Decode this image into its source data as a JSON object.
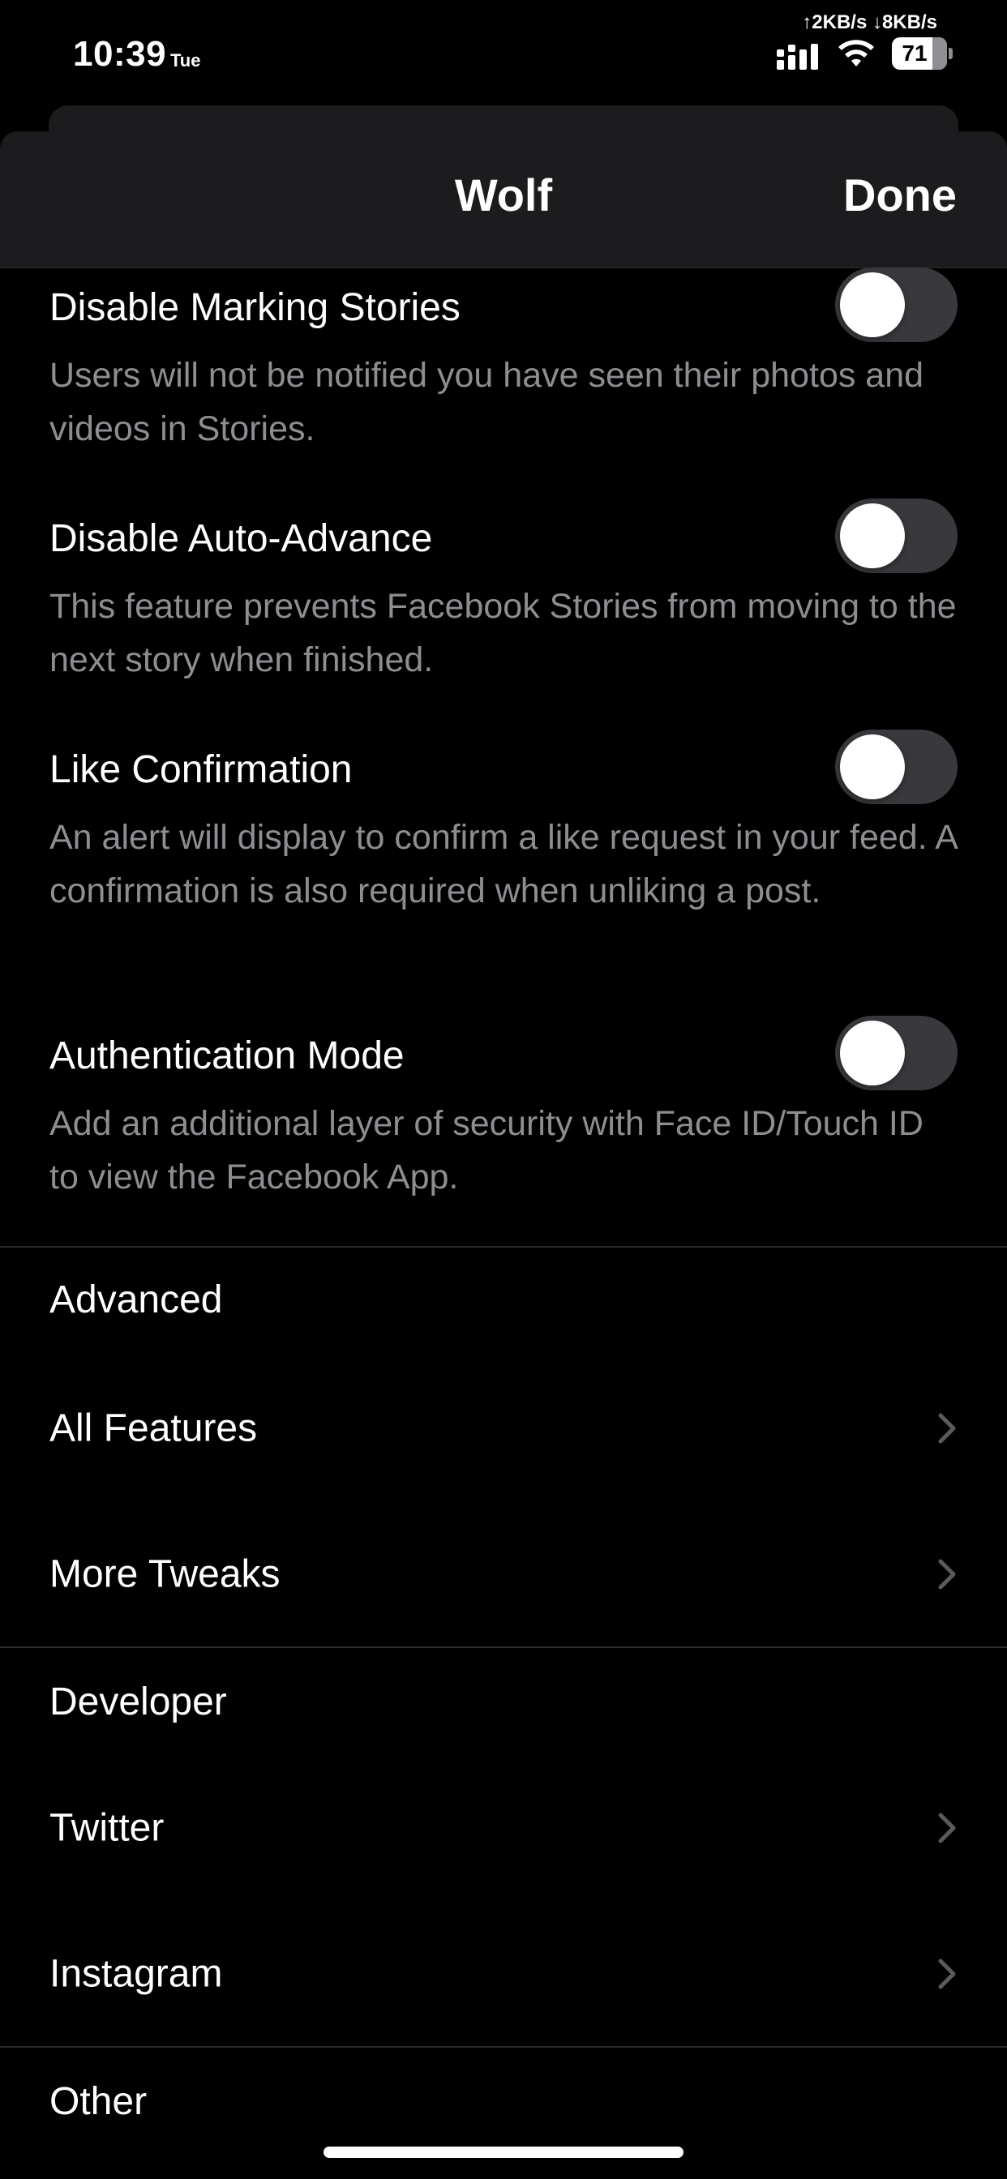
{
  "status_bar": {
    "time": "10:39",
    "day": "Tue",
    "net_speed": "↑2KB/s ↓8KB/s",
    "battery_level": "71"
  },
  "nav": {
    "title": "Wolf",
    "done_label": "Done"
  },
  "toggles": [
    {
      "label": "Disable Marking Stories",
      "description": "Users will not be notified you have seen their photos and videos in Stories.",
      "on": false
    },
    {
      "label": "Disable Auto-Advance",
      "description": "This feature prevents Facebook Stories from moving to the next story when finished.",
      "on": false
    },
    {
      "label": "Like Confirmation",
      "description": "An alert will display to confirm a like request in your feed. A confirmation is also required when unliking a post.",
      "on": false
    },
    {
      "label": "Authentication Mode",
      "description": "Add an additional layer of security with Face ID/Touch ID to view the Facebook App.",
      "on": false
    }
  ],
  "sections": {
    "advanced": {
      "header": "Advanced",
      "items": [
        "All Features",
        "More Tweaks"
      ]
    },
    "developer": {
      "header": "Developer",
      "items": [
        "Twitter",
        "Instagram"
      ]
    },
    "other": {
      "header": "Other"
    }
  },
  "colors": {
    "background": "#000000",
    "nav_background": "#1c1c1e",
    "secondary_text": "#8d8d92",
    "toggle_off": "#39393d"
  }
}
